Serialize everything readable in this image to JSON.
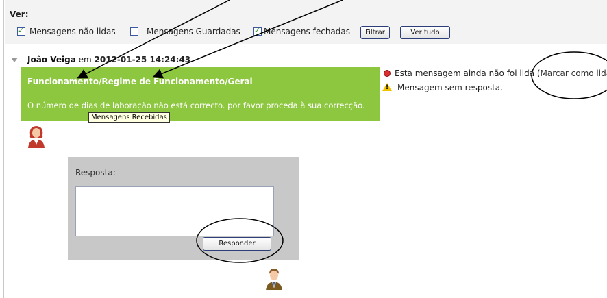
{
  "filter": {
    "ver_label": "Ver:",
    "options": [
      {
        "label": "Mensagens não lidas",
        "checked": true
      },
      {
        "label": "Mensagens Guardadas",
        "checked": false
      },
      {
        "label": "Mensagens fechadas",
        "checked": true
      }
    ],
    "filtrar_label": "Filtrar",
    "ver_tudo_label": "Ver tudo"
  },
  "message": {
    "author": "João Veiga",
    "connector": " em ",
    "datetime": "2012-01-25 14:24:43",
    "title": "Funcionamento/Regime de Funcionamento/Geral",
    "body": "O número de dias de laboração não está correcto. por favor proceda à sua correcção.",
    "tooltip": "Mensagens Recebidas",
    "status_unread": "Esta mensagem ainda não foi lida (",
    "mark_read_link": "Marcar como lida",
    "status_no_reply": "Mensagem sem resposta."
  },
  "reply": {
    "label": "Resposta:",
    "textarea_value": "",
    "responder_label": "Responder"
  },
  "colors": {
    "message_bg": "#8dc63f",
    "reply_panel_bg": "#c8c8c8",
    "filter_bar_bg": "#f3f3f3"
  },
  "icons": [
    "expand-triangle-icon",
    "female-user-icon",
    "male-user-icon",
    "unread-red-dot-icon",
    "warning-icon"
  ]
}
